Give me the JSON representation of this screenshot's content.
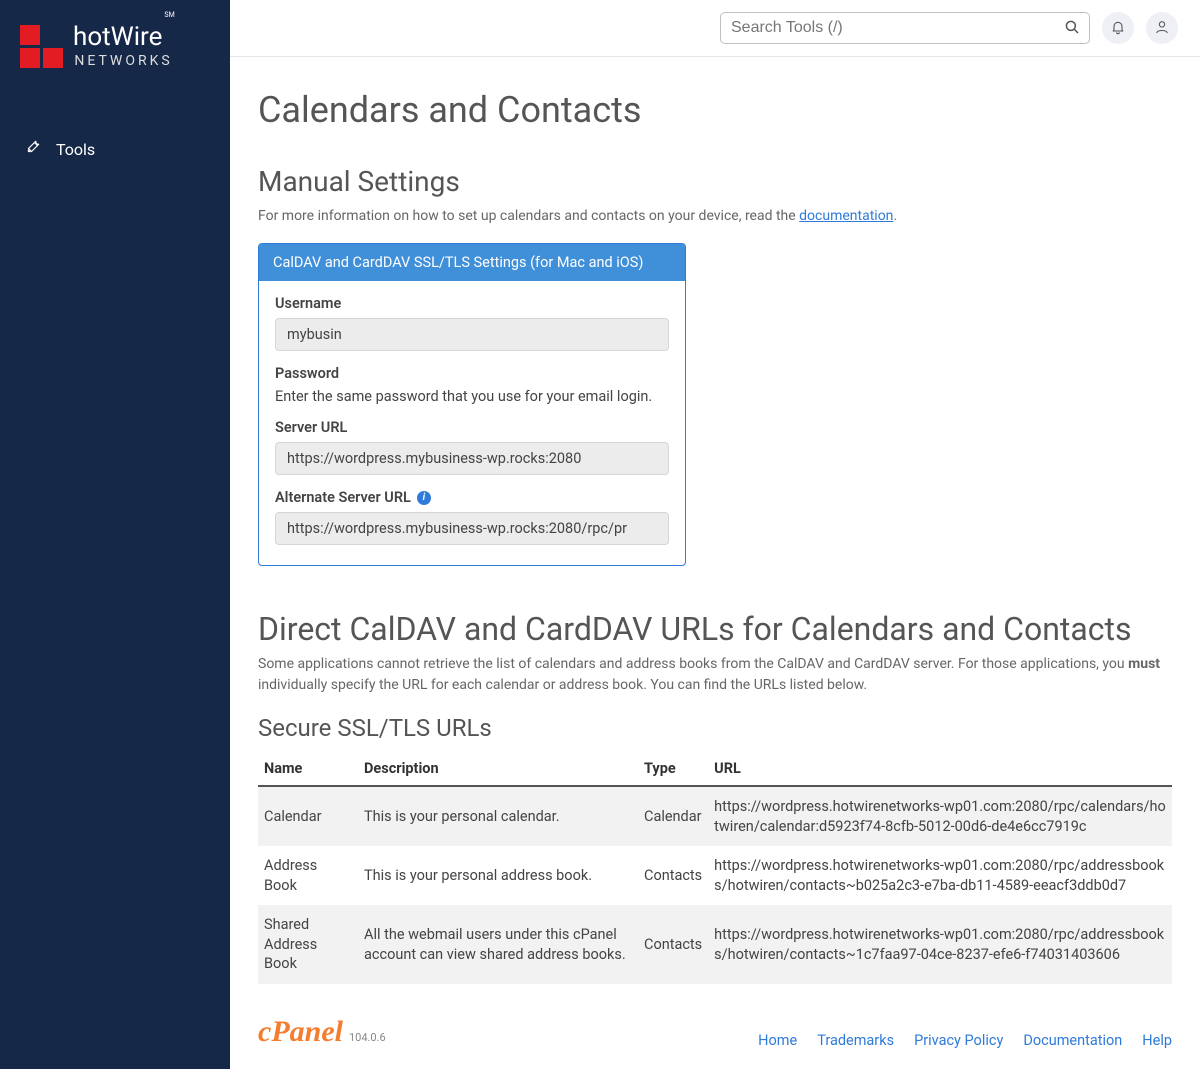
{
  "brand": {
    "line1": "hotWire",
    "line2": "NETWORKS",
    "sm": "SM"
  },
  "sidebar": {
    "tools_label": "Tools"
  },
  "topbar": {
    "search_placeholder": "Search Tools (/)"
  },
  "page": {
    "title": "Calendars and Contacts",
    "manual_title": "Manual Settings",
    "manual_desc_pre": "For more information on how to set up calendars and contacts on your device, read the ",
    "manual_desc_link": "documentation",
    "manual_desc_post": ".",
    "panel_head": "CalDAV and CardDAV SSL/TLS Settings (for Mac and iOS)",
    "fields": {
      "username_label": "Username",
      "username_value": "mybusin",
      "password_label": "Password",
      "password_hint": "Enter the same password that you use for your email login.",
      "server_label": "Server URL",
      "server_value": "https://wordpress.mybusiness-wp.rocks:2080",
      "alt_label": "Alternate Server URL",
      "alt_value": "https://wordpress.mybusiness-wp.rocks:2080/rpc/pr"
    },
    "direct_title": "Direct CalDAV and CardDAV URLs for Calendars and Contacts",
    "direct_desc_pre": "Some applications cannot retrieve the list of calendars and address books from the CalDAV and CardDAV server. For those applications, you ",
    "direct_must": "must",
    "direct_desc_post": " individually specify the URL for each calendar or address book. You can find the URLs listed below.",
    "secure_title": "Secure SSL/TLS URLs",
    "table": {
      "headers": {
        "name": "Name",
        "desc": "Description",
        "type": "Type",
        "url": "URL"
      },
      "rows": [
        {
          "name": "Calendar",
          "desc": "This is your personal calendar.",
          "type": "Calendar",
          "url": "https://wordpress.hotwirenetworks-wp01.com:2080/rpc/calendars/hotwiren/calendar:d5923f74-8cfb-5012-00d6-de4e6cc7919c"
        },
        {
          "name": "Address Book",
          "desc": "This is your personal address book.",
          "type": "Contacts",
          "url": "https://wordpress.hotwirenetworks-wp01.com:2080/rpc/addressbooks/hotwiren/contacts~b025a2c3-e7ba-db11-4589-eeacf3ddb0d7"
        },
        {
          "name": "Shared Address Book",
          "desc": "All the webmail users under this cPanel account can view shared address books.",
          "type": "Contacts",
          "url": "https://wordpress.hotwirenetworks-wp01.com:2080/rpc/addressbooks/hotwiren/contacts~1c7faa97-04ce-8237-efe6-f74031403606"
        }
      ]
    }
  },
  "footer": {
    "logo": "cPanel",
    "version": "104.0.6",
    "links": [
      {
        "label": "Home"
      },
      {
        "label": "Trademarks"
      },
      {
        "label": "Privacy Policy"
      },
      {
        "label": "Documentation"
      },
      {
        "label": "Help"
      }
    ]
  }
}
